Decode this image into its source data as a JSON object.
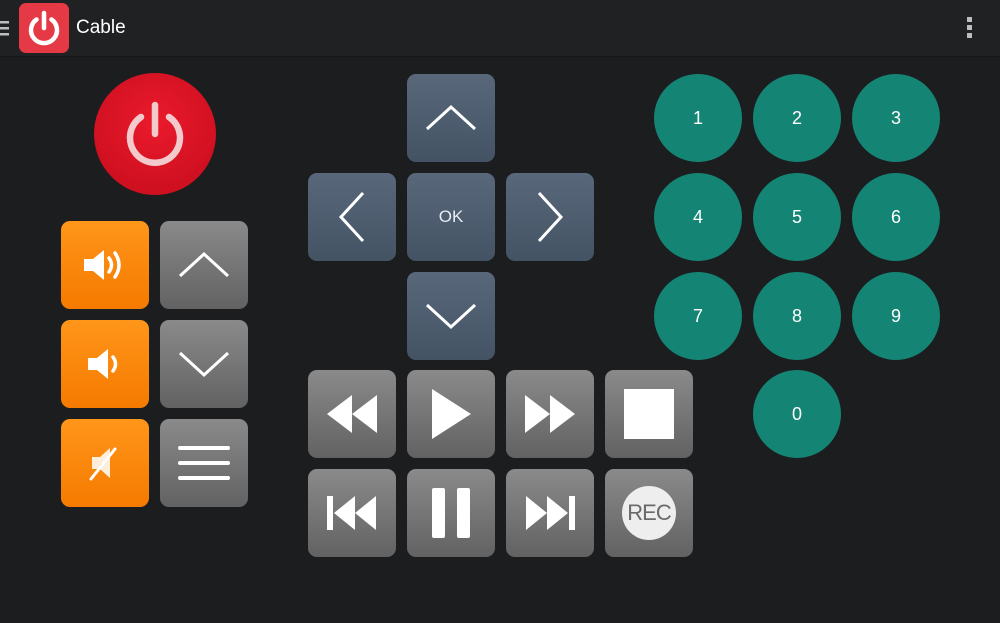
{
  "app_bar": {
    "title": "Cable",
    "icons": [
      "menu-icon",
      "power-icon",
      "overflow-menu-icon"
    ],
    "brand_color": "#e53945"
  },
  "remote": {
    "power": {
      "icon": "power-icon",
      "color": "#d8101f"
    },
    "volume": {
      "up_icon": "volume-up-icon",
      "down_icon": "volume-down-icon",
      "mute_icon": "mute-icon",
      "color": "#fb8a10"
    },
    "channel": {
      "up_icon": "chevron-up-icon",
      "down_icon": "chevron-down-icon",
      "menu_icon": "hamburger-icon"
    },
    "dpad": {
      "ok_label": "OK",
      "icons": [
        "chevron-up-icon",
        "chevron-left-icon",
        "chevron-right-icon",
        "chevron-down-icon"
      ],
      "color": "#4e5e70"
    },
    "transport": {
      "icons": [
        "rewind-icon",
        "play-icon",
        "fast-forward-icon",
        "stop-icon",
        "skip-previous-icon",
        "pause-icon",
        "skip-next-icon"
      ],
      "rec_label": "REC"
    },
    "keypad": {
      "keys": [
        "1",
        "2",
        "3",
        "4",
        "5",
        "6",
        "7",
        "8",
        "9",
        "0"
      ],
      "color": "#148574"
    }
  }
}
